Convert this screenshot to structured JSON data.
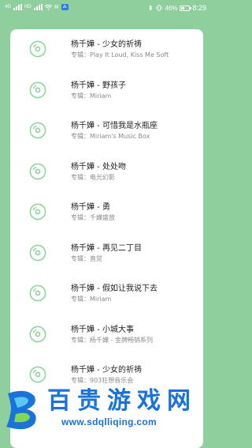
{
  "status_bar": {
    "network_type": "4G",
    "network_badge": "HD",
    "battery_percent": "46%",
    "battery_level": 0.46,
    "time": "8:29"
  },
  "songs": [
    {
      "title": "杨千嬅 - 少女的祈祷",
      "album": "专辑：Play It Loud, Kiss Me Soft"
    },
    {
      "title": "杨千嬅 - 野孩子",
      "album": "专辑：Miriam"
    },
    {
      "title": "杨千嬅 - 可惜我是水瓶座",
      "album": "专辑：Miriam's Music Box"
    },
    {
      "title": "杨千嬅 - 处处吻",
      "album": "专辑：电光幻影"
    },
    {
      "title": "杨千嬅 - 勇",
      "album": "专辑：千嬅盛放"
    },
    {
      "title": "杨千嬅 - 再见二丁目",
      "album": "专辑：直觉"
    },
    {
      "title": "杨千嬅 - 假如让我说下去",
      "album": "专辑：Miriam"
    },
    {
      "title": "杨千嬅 - 小城大事",
      "album": "专辑：杨千嬅 - 金牌畅销系列"
    },
    {
      "title": "杨千嬅 - 少女的祈祷",
      "album": "专辑：903狂想音乐会"
    }
  ],
  "watermark": {
    "brand_chars": [
      "百",
      "贵",
      "游",
      "戏",
      "网"
    ],
    "url": "www.sdqlliqing.com"
  },
  "colors": {
    "background": "#8fcf9e",
    "card": "#ffffff",
    "disc_icon": "#8fd49b",
    "title_text": "#222222",
    "album_text": "#8a8a8a",
    "watermark_blue": "#1a73d9"
  }
}
